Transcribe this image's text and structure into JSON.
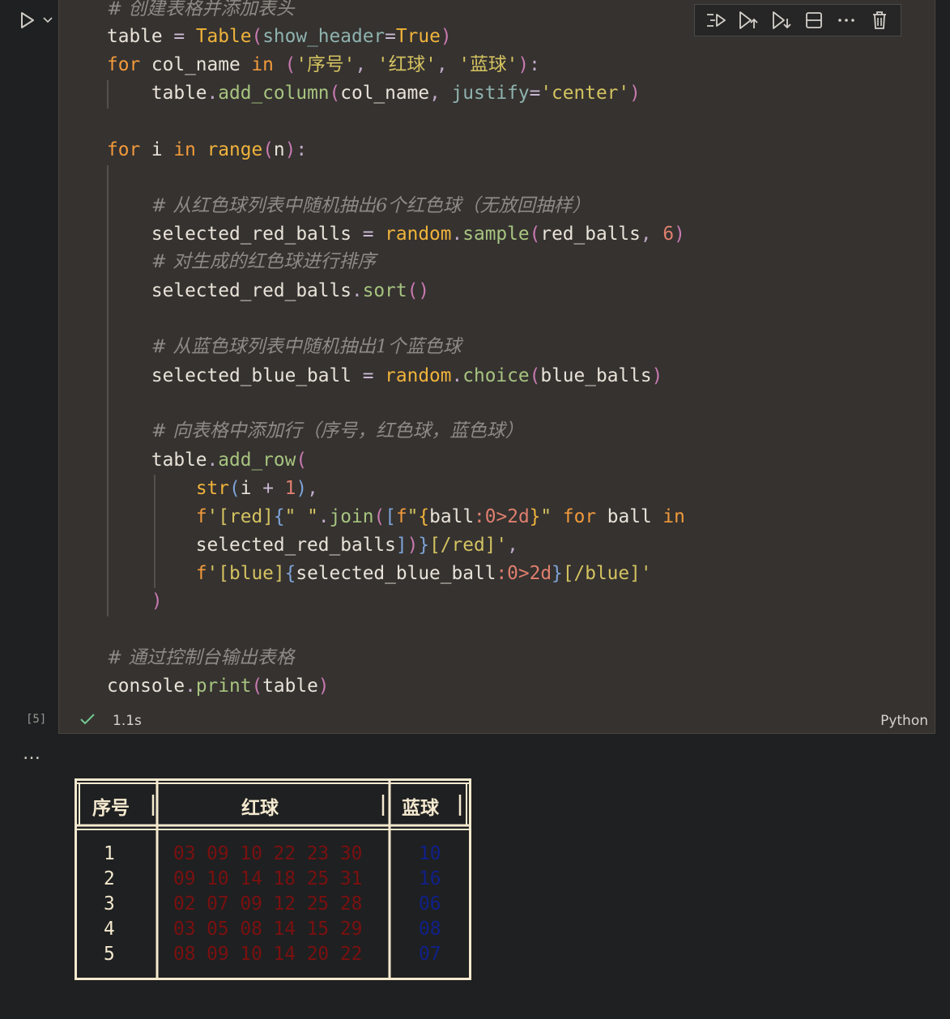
{
  "cell": {
    "execution_count": "[5]",
    "status_time": "1.1s",
    "language": "Python",
    "code_lines": [
      "# 创建表格并添加表头",
      "table = Table(show_header=True)",
      "for col_name in ('序号', '红球', '蓝球'):",
      "    table.add_column(col_name, justify='center')",
      "",
      "for i in range(n):",
      "",
      "    # 从红色球列表中随机抽出6个红色球（无放回抽样）",
      "    selected_red_balls = random.sample(red_balls, 6)",
      "    # 对生成的红色球进行排序",
      "    selected_red_balls.sort()",
      "",
      "    # 从蓝色球列表中随机抽出1个蓝色球",
      "    selected_blue_ball = random.choice(blue_balls)",
      "",
      "    # 向表格中添加行（序号，红色球，蓝色球）",
      "    table.add_row(",
      "        str(i + 1),",
      "        f'[red]{\" \".join([f\"{ball:0>2d}\" for ball in",
      "        selected_red_balls])}[/red]',",
      "        f'[blue]{selected_blue_ball:0>2d}[/blue]'",
      "    )",
      "",
      "# 通过控制台输出表格",
      "console.print(table)"
    ]
  },
  "toolbar": {
    "icons": [
      "run-by-line-icon",
      "execute-above-icon",
      "execute-below-icon",
      "split-cell-icon",
      "more-actions-icon",
      "delete-icon"
    ]
  },
  "output": {
    "ellipsis": "…",
    "headers": [
      "序号",
      "红球",
      "蓝球"
    ],
    "rows": [
      {
        "index": "1",
        "red": "03 09 10 22 23 30",
        "blue": "10"
      },
      {
        "index": "2",
        "red": "09 10 14 18 25 31",
        "blue": "16"
      },
      {
        "index": "3",
        "red": "02 07 09 12 25 28",
        "blue": "06"
      },
      {
        "index": "4",
        "red": "03 05 08 14 15 29",
        "blue": "08"
      },
      {
        "index": "5",
        "red": "08 09 10 14 20 22",
        "blue": "07"
      }
    ]
  },
  "colors": {
    "background": "#1f2021",
    "cell_background": "#353230",
    "red_text": "#7a1010",
    "blue_text": "#10208a",
    "table_border": "#f4e9cf"
  }
}
